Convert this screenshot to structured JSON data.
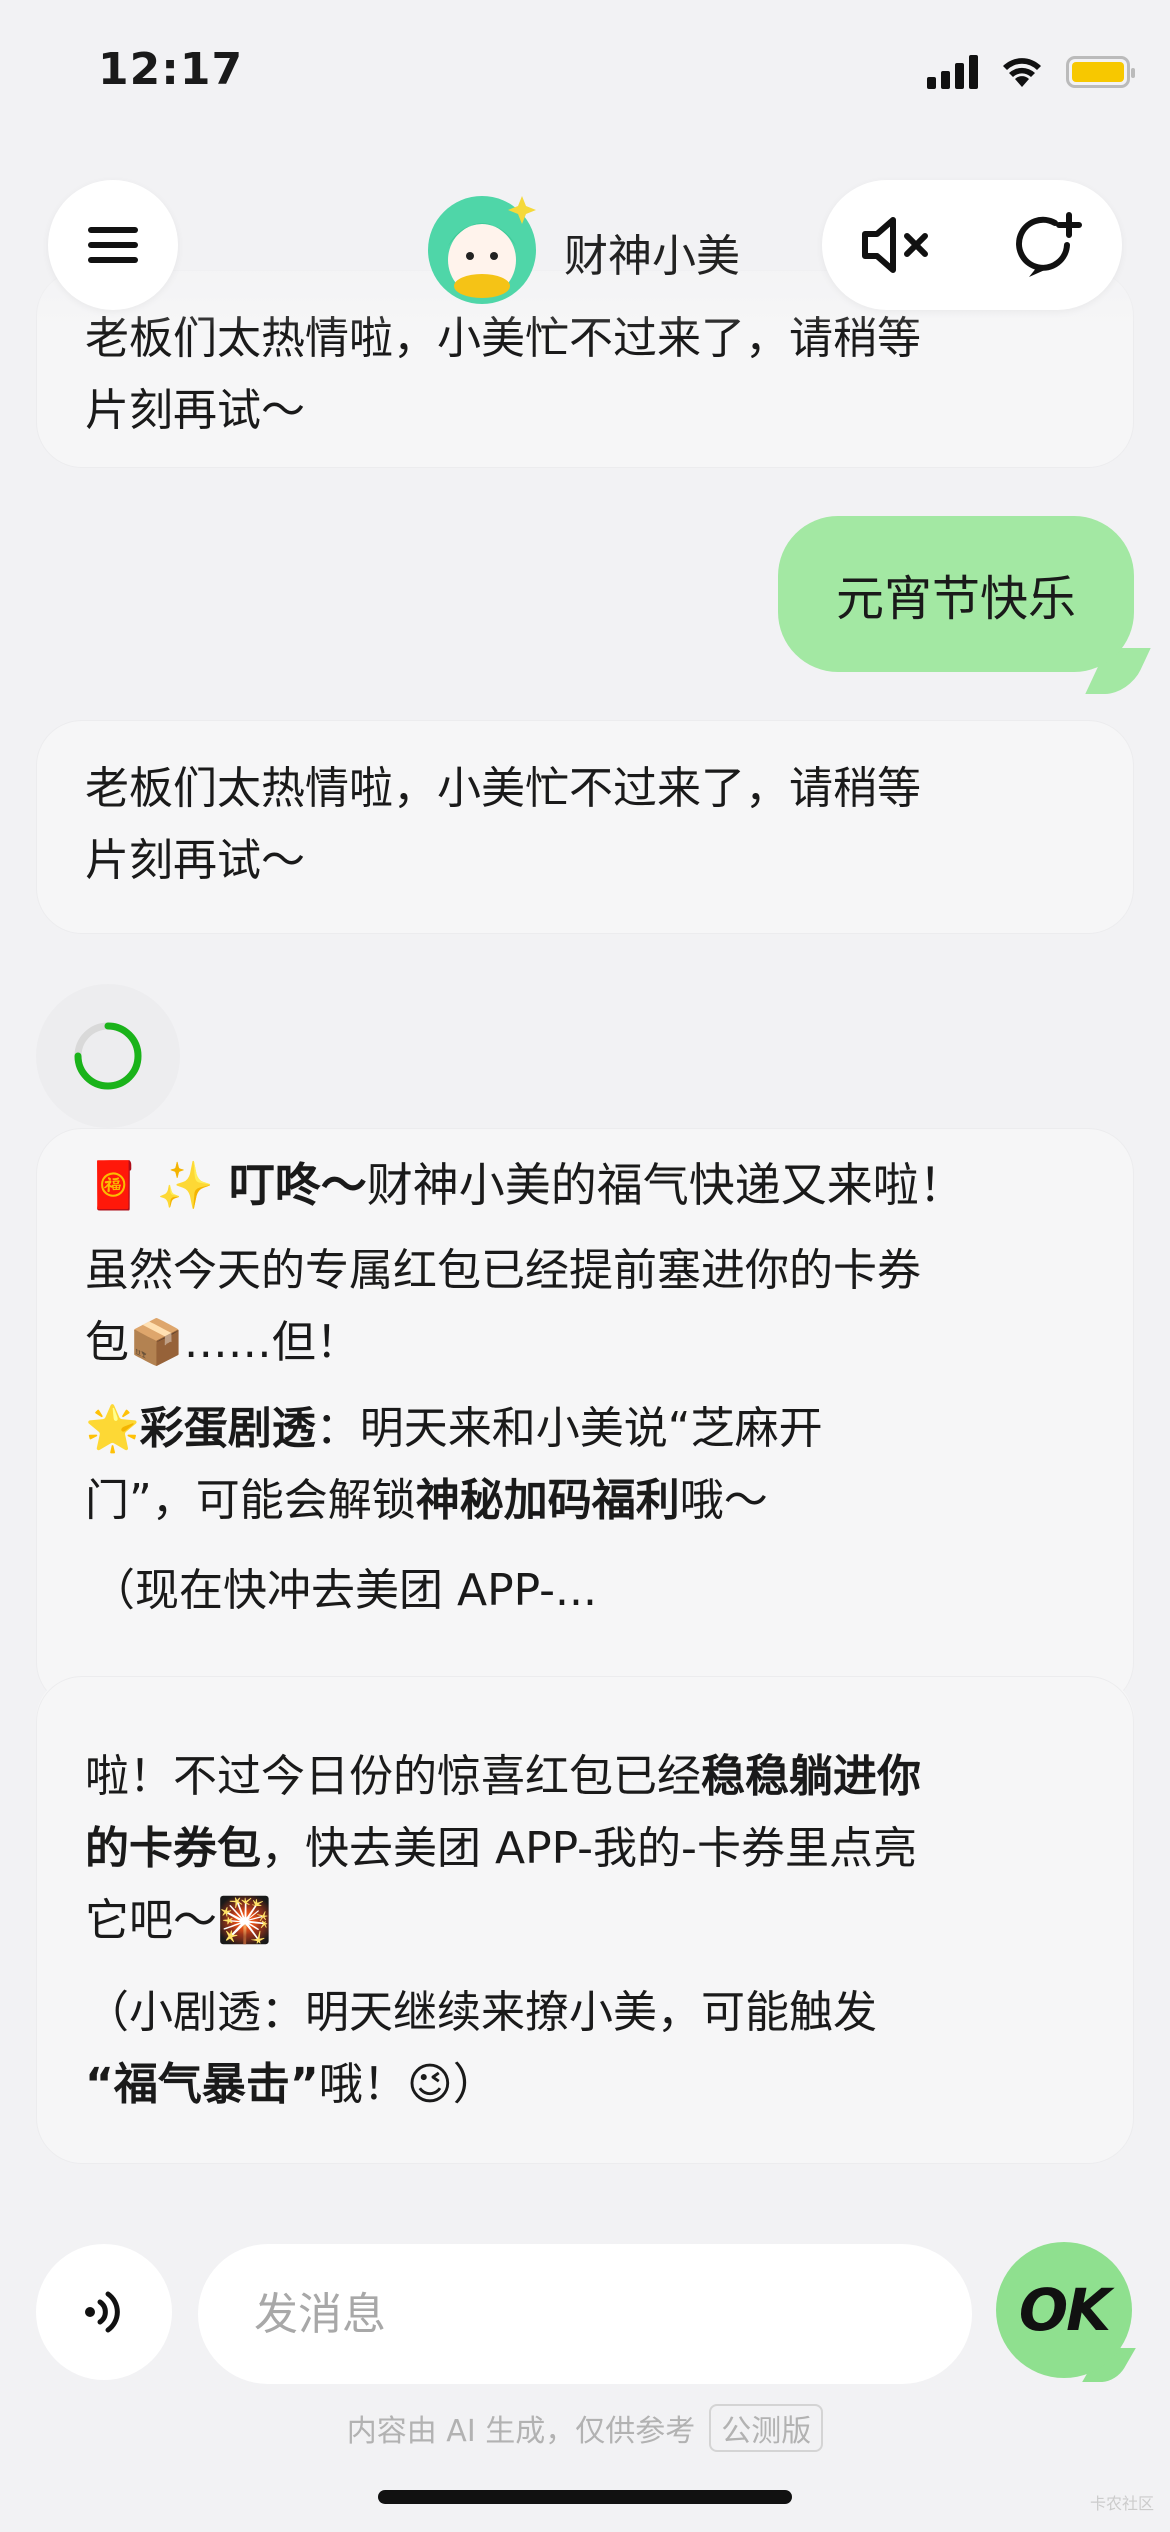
{
  "status_bar": {
    "time": "12:17",
    "battery_color": "#f7c800"
  },
  "header": {
    "title": "财神小美",
    "menu_icon": "hamburger-menu-icon",
    "mute_icon": "speaker-muted-icon",
    "new_chat_icon": "new-chat-icon"
  },
  "messages": {
    "top_bot_partial": {
      "line1": "老板们太热情啦，小美忙不过来了，请稍等",
      "line2": "片刻再试～"
    },
    "user_message": "元宵节快乐",
    "bot_busy": {
      "line1": "老板们太热情啦，小美忙不过来了，请稍等",
      "line2": "片刻再试～"
    },
    "card1": {
      "p1_emoji": "🧧 ✨ ",
      "p1_bold": "叮咚～",
      "p1_rest": "财神小美的福气快递又来啦！",
      "p2_line1": "虽然今天的专属红包已经提前塞进你的卡券",
      "p2_line2": "包📦……但！",
      "p3_emoji": "🌟",
      "p3_bold": "彩蛋剧透",
      "p3_rest": "：明天来和小美说“芝麻开",
      "p3_line2_pre": "门”，可能会解锁",
      "p3_line2_bold": "神秘加码福利",
      "p3_line2_post": "哦～",
      "p4": "（现在快冲去美团 APP-..."
    },
    "card2": {
      "l1_pre": "啦！不过今日份的惊喜红包已经",
      "l1_bold": "稳稳躺进你",
      "l2_bold": "的卡券包",
      "l2_post": "，快去美团 APP-我的-卡券里点亮",
      "l3": "它吧～🎇",
      "l4": "（小剧透：明天继续来撩小美，可能触发",
      "l5_bold": "“福气暴击”",
      "l5_post": "哦！😉）"
    }
  },
  "input": {
    "placeholder": "发消息",
    "voice_icon": "voice-input-icon",
    "send_label": "OK"
  },
  "footer": {
    "disclaimer": "内容由 AI 生成，仅供参考",
    "beta": "公测版",
    "watermark": "卡农社区"
  }
}
